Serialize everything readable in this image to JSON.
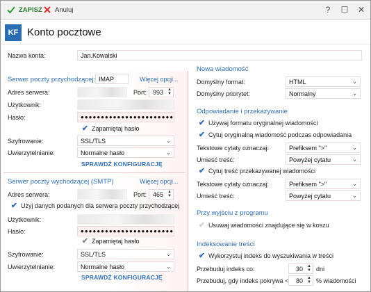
{
  "toolbar": {
    "save_label": "ZAPISZ",
    "cancel_label": "Anuluj"
  },
  "window_controls": {
    "help": "?",
    "maximize": "☐",
    "close": "✕"
  },
  "header": {
    "badge": "KF",
    "title": "Konto pocztowe"
  },
  "account": {
    "name_label": "Nazwa konta:",
    "name_value": "Jan.Kowalski"
  },
  "incoming": {
    "title": "Serwer poczty przychodzącej:",
    "protocol": "IMAP",
    "more_options": "Więcej opcji...",
    "address_label": "Adres serwera:",
    "port_label": "Port:",
    "port_value": "993",
    "user_label": "Użytkownik:",
    "password_label": "Hasło:",
    "password_value": "●●●●●●●●●●●●●●●●●●●●●●●●●●",
    "remember_label": "Zapamiętaj hasło",
    "encryption_label": "Szyfrowanie:",
    "encryption_value": "SSL/TLS",
    "auth_label": "Uwierzytelnianie:",
    "auth_value": "Normalne hasło",
    "check_config": "SPRAWDŹ KONFIGURACJĘ"
  },
  "outgoing": {
    "title": "Serwer poczty wychodzącej (SMTP)",
    "more_options": "Więcej opcji...",
    "address_label": "Adres serwera:",
    "port_label": "Port:",
    "port_value": "465",
    "use_incoming_label": "Użyj danych podanych dla serwera poczty przychodzącej",
    "user_label": "Użytkownik:",
    "password_label": "Hasło:",
    "password_value": "●●●●●●●●●●●●●●●●●●●●●●●●●●",
    "remember_label": "Zapamiętaj hasło",
    "encryption_label": "Szyfrowanie:",
    "encryption_value": "SSL/TLS",
    "auth_label": "Uwierzytelnianie:",
    "auth_value": "Normalne hasło",
    "check_config": "SPRAWDŹ KONFIGURACJĘ"
  },
  "new_message": {
    "title": "Nowa wiadomość",
    "format_label": "Domyślny format:",
    "format_value": "HTML",
    "priority_label": "Domyślny priorytet:",
    "priority_value": "Normalny"
  },
  "reply": {
    "title": "Odpowiadanie i przekazywanie",
    "use_original_format": "Używaj formatu oryginalnej wiadomości",
    "quote_original": "Cytuj oryginalną wiadomość podczas odpowiadania",
    "quote_mark_label": "Tekstowe cytaty oznaczaj:",
    "quote_mark_value": "Prefiksem \">\"",
    "place_text_label": "Umieść treść:",
    "place_text_value": "Powyżej cytatu",
    "quote_forwarded": "Cytuj treść przekazywanej wiadomości",
    "quote_mark_label2": "Tekstowe cytaty oznaczaj:",
    "quote_mark_value2": "Prefiksem \">\"",
    "place_text_label2": "Umieść treść:",
    "place_text_value2": "Powyżej cytatu"
  },
  "exit": {
    "title": "Przy wyjściu z programu",
    "delete_trash": "Usuwaj wiadomości znajdujące się w koszu"
  },
  "indexing": {
    "title": "Indeksowanie treści",
    "use_index": "Wykorzystuj indeks do wyszukiwania w treści",
    "rebuild_every_label": "Przebuduj indeks co:",
    "rebuild_every_value": "30",
    "rebuild_every_unit": "dni",
    "rebuild_coverage_label": "Przebuduj, gdy indeks pokrywa <",
    "rebuild_coverage_value": "80",
    "rebuild_coverage_unit": "% wiadomości"
  }
}
